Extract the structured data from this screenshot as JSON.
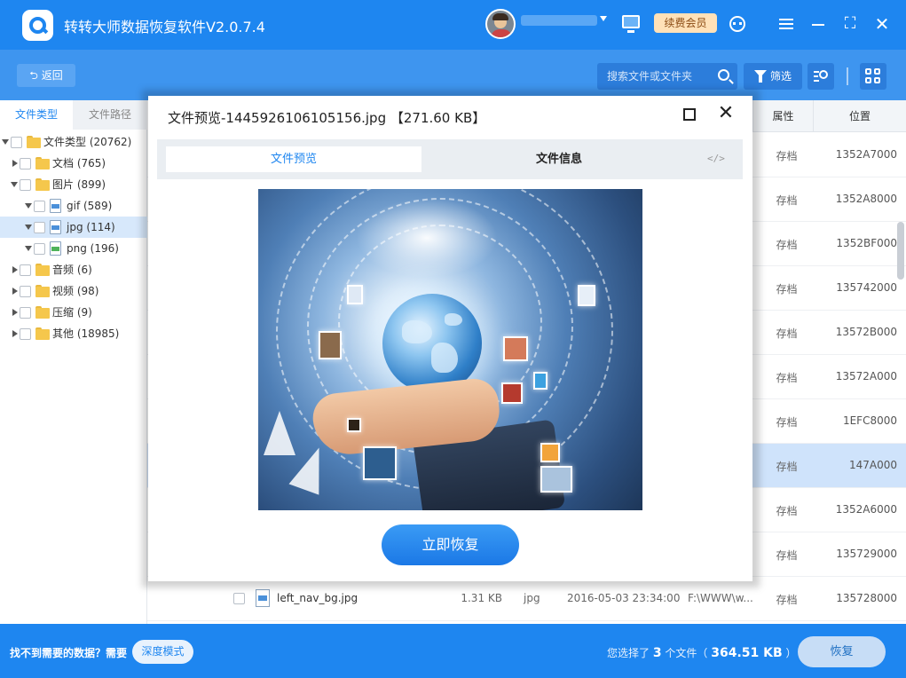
{
  "window": {
    "title": "转转大师数据恢复软件V2.0.7.4",
    "vip_label": "续费会员"
  },
  "toolbar": {
    "back_label": "返回",
    "search_placeholder": "搜索文件或文件夹",
    "filter_label": "筛选"
  },
  "left_panel": {
    "tabs": [
      "文件类型",
      "文件路径"
    ],
    "tree": [
      {
        "label": "文件类型 (20762)",
        "level": 0,
        "expanded": true,
        "icon": "folder-icon"
      },
      {
        "label": "文档 (765)",
        "level": 1,
        "expanded": false,
        "icon": "folder-icon"
      },
      {
        "label": "图片 (899)",
        "level": 1,
        "expanded": true,
        "icon": "folder-icon"
      },
      {
        "label": "gif (589)",
        "level": 2,
        "expanded": true,
        "icon": "image-file-icon"
      },
      {
        "label": "jpg (114)",
        "level": 2,
        "expanded": true,
        "icon": "image-file-icon",
        "selected": true
      },
      {
        "label": "png (196)",
        "level": 2,
        "expanded": true,
        "icon": "png-file-icon"
      },
      {
        "label": "音频 (6)",
        "level": 1,
        "expanded": false,
        "icon": "folder-icon"
      },
      {
        "label": "视频 (98)",
        "level": 1,
        "expanded": false,
        "icon": "folder-icon"
      },
      {
        "label": "压缩 (9)",
        "level": 1,
        "expanded": false,
        "icon": "folder-icon"
      },
      {
        "label": "其他 (18985)",
        "level": 1,
        "expanded": false,
        "icon": "folder-icon"
      }
    ]
  },
  "table": {
    "headers": {
      "attr": "属性",
      "location": "位置"
    },
    "rows": [
      {
        "attr": "存档",
        "location": "1352A7000"
      },
      {
        "attr": "存档",
        "location": "1352A8000"
      },
      {
        "attr": "存档",
        "location": "1352BF000"
      },
      {
        "attr": "存档",
        "location": "135742000"
      },
      {
        "attr": "存档",
        "location": "13572B000"
      },
      {
        "attr": "存档",
        "location": "13572A000"
      },
      {
        "attr": "存档",
        "location": "1EFC8000"
      },
      {
        "attr": "存档",
        "location": "147A000",
        "selected": true
      },
      {
        "attr": "存档",
        "location": "1352A6000"
      },
      {
        "attr": "存档",
        "location": "135729000"
      },
      {
        "name": "left_nav_bg.jpg",
        "size": "1.31 KB",
        "type": "jpg",
        "date": "2016-05-03 23:34:00",
        "path": "F:\\WWW\\w...",
        "attr": "存档",
        "location": "135728000"
      }
    ]
  },
  "dialog": {
    "title": "文件预览-1445926106105156.jpg 【271.60 KB】",
    "tabs": [
      "文件预览",
      "文件信息"
    ],
    "code_label": "</>",
    "restore_label": "立即恢复"
  },
  "bottom": {
    "hint": "找不到需要的数据？需要",
    "deep_mode_label": "深度模式",
    "summary_prefix": "您选择了",
    "summary_count": "3",
    "summary_mid": "个文件（",
    "summary_size": "364.51 KB",
    "summary_suffix": "）",
    "recover_label": "恢复"
  },
  "colors": {
    "brand": "#1e86f0",
    "toolbar": "#3e95ef",
    "selection": "#d7e8fb",
    "vip": "#ffe1b8"
  }
}
